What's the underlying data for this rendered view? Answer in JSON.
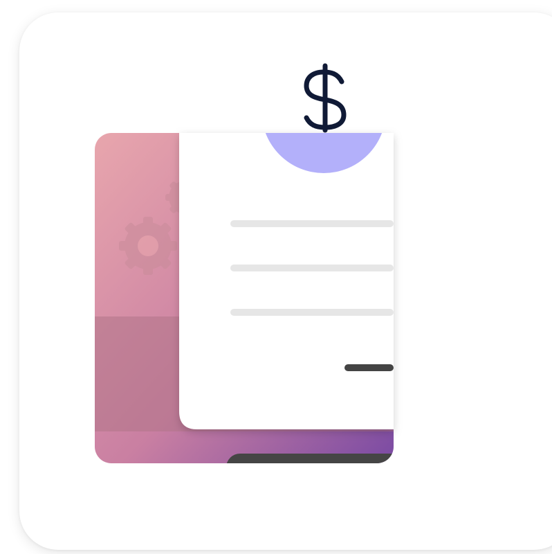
{
  "icon": {
    "name": "invoice-app-icon",
    "symbol": "$",
    "colors": {
      "panel_gradient_start": "#e8a6ad",
      "panel_gradient_mid": "#c97fa2",
      "panel_gradient_end": "#7a4aa3",
      "panel_band": "#b07488",
      "gear": "#c98c9a",
      "document": "#ffffff",
      "text_line": "#e6e6e6",
      "total_bar": "#444444",
      "footer_bar": "#454545",
      "coin_half": "#b3b0fa",
      "dollar_stroke": "#101a36"
    }
  }
}
